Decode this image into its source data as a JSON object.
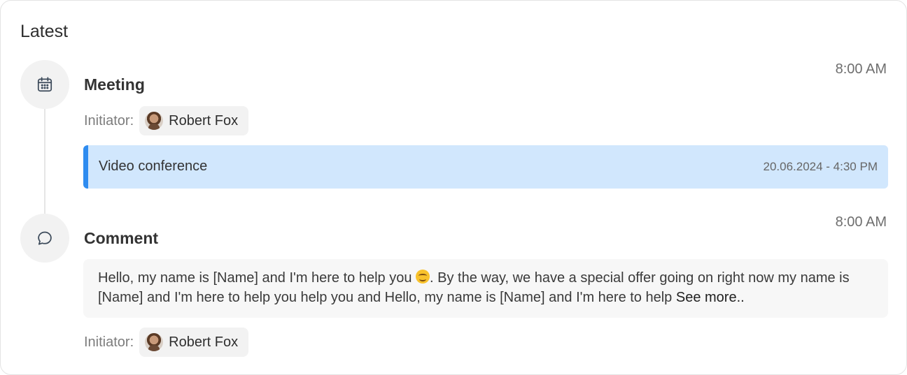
{
  "section": {
    "title": "Latest"
  },
  "meeting": {
    "icon": "calendar-icon",
    "title": "Meeting",
    "time": "8:00 AM",
    "initiator_label": "Initiator:",
    "initiator_name": "Robert Fox",
    "event": {
      "text": "Video conference",
      "date": "20.06.2024 - 4:30 PM",
      "accent_color": "#2f8cf0",
      "background_color": "#d1e7fd"
    }
  },
  "comment": {
    "icon": "comment-icon",
    "title": "Comment",
    "time": "8:00 AM",
    "text_before_emoji": "Hello, my name is [Name] and I'm here to help you ",
    "emoji": "smiling-face-emoji",
    "text_after_emoji": ". By the way, we have a special offer going on right now my name is [Name] and I'm here to help you help you and Hello, my name is [Name] and I'm here to help ",
    "see_more": "See more..",
    "initiator_label": "Initiator:",
    "initiator_name": "Robert Fox"
  }
}
